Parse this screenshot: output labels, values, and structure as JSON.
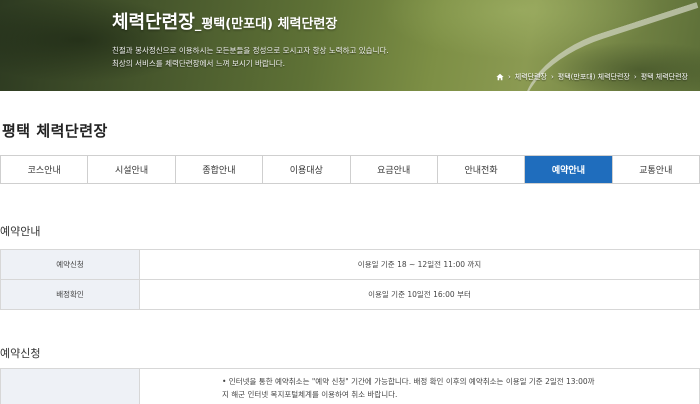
{
  "hero": {
    "title_main": "체력단련장",
    "title_sub": "_평택(만포대) 체력단련장",
    "desc_line1": "친절과 봉사정신으로 이용하시는 모든분들을 정성으로 모시고자 항상 노력하고 있습니다.",
    "desc_line2": "최상의 서비스를 체력단련장에서 느껴 보시기 바랍니다.",
    "breadcrumb": [
      "체력단련장",
      "평택(만포대) 체력단련장",
      "평택 체력단련장"
    ],
    "home_icon": "home-icon"
  },
  "page_title": "평택 체력단련장",
  "tabs": [
    {
      "label": "코스안내"
    },
    {
      "label": "시설안내"
    },
    {
      "label": "종합안내"
    },
    {
      "label": "이용대상"
    },
    {
      "label": "요금안내"
    },
    {
      "label": "안내전화"
    },
    {
      "label": "예약안내",
      "active": true
    },
    {
      "label": "교통안내"
    }
  ],
  "reservation_info": {
    "heading": "예약안내",
    "rows": [
      {
        "label": "예약신청",
        "value": "이용일 기준 18 ~ 12일전 11:00 까지"
      },
      {
        "label": "배정확인",
        "value": "이용일 기준 10일전 16:00 부터"
      }
    ]
  },
  "reservation_apply": {
    "heading": "예약신청",
    "note_line1": "• 인터넷을 통한 예약취소는 \"예약 신청\" 기간에 가능합니다. 배정 확인 이후의 예약취소는 이용일 기준 2일전 13:00까",
    "note_line2": "지 해군 인터넷 복지포털체계를 이용하여 취소 바랍니다."
  },
  "colors": {
    "accent": "#1f6dbd",
    "label_bg": "#eef1f6",
    "border": "#cfcfcf"
  }
}
